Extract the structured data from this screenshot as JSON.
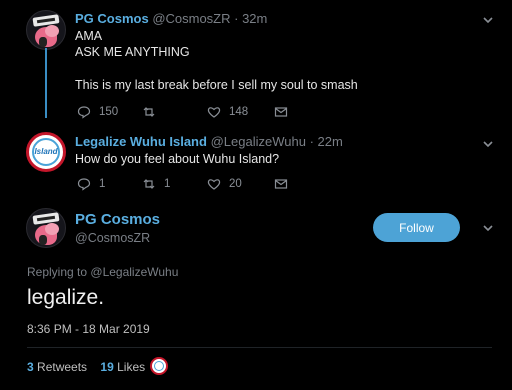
{
  "tweet1": {
    "name": "PG Cosmos",
    "handle": "@CosmosZR",
    "time": "· 32m",
    "lines": [
      "AMA",
      "ASK ME ANYTHING",
      "",
      "This is my last break before I sell my soul to smash"
    ],
    "replies": "150",
    "retweets": "",
    "likes": "148"
  },
  "tweet2": {
    "name": "Legalize Wuhu Island",
    "handle": "@LegalizeWuhu",
    "time": "· 22m",
    "avatar_text": "Island",
    "text": "How do you feel about Wuhu Island?",
    "replies": "1",
    "retweets": "1",
    "likes": "20"
  },
  "main": {
    "name": "PG Cosmos",
    "handle": "@CosmosZR",
    "follow_label": "Follow",
    "replying_prefix": "Replying to",
    "replying_to": "@LegalizeWuhu",
    "text": "legalize.",
    "timestamp": "8:36 PM - 18 Mar 2019",
    "retweets_count": "3",
    "retweets_label": "Retweets",
    "likes_count": "19",
    "likes_label": "Likes"
  },
  "colors": {
    "background": "#000000",
    "accent": "#4da3d6",
    "name": "#5aaee0",
    "muted": "#7a7f86"
  },
  "icons": [
    "reply-icon",
    "retweet-icon",
    "like-icon",
    "dm-icon",
    "chevron-down-icon"
  ]
}
